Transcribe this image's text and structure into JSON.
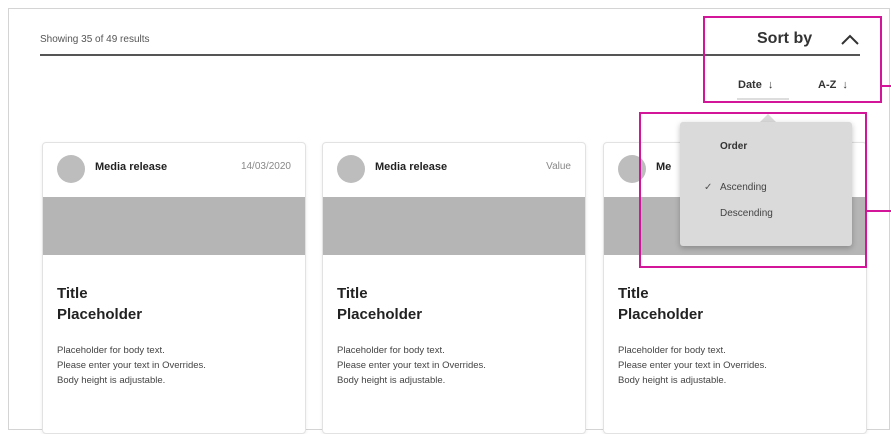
{
  "results_text": "Showing 35 of 49 results",
  "sort": {
    "label": "Sort by",
    "chevron_icon": "chevron-up-icon",
    "options": [
      {
        "label": "Date",
        "arrow": "↓"
      },
      {
        "label": "A-Z",
        "arrow": "↓"
      }
    ]
  },
  "popover": {
    "heading": "Order",
    "items": [
      {
        "label": "Ascending",
        "selected": true,
        "check": "✓"
      },
      {
        "label": "Descending",
        "selected": false
      }
    ]
  },
  "cards": [
    {
      "tag": "Media release",
      "meta": "14/03/2020",
      "title_line1": "Title",
      "title_line2": "Placeholder",
      "body1": "Placeholder for body text.",
      "body2": "Please enter your text in Overrides.",
      "body3": "Body height is adjustable."
    },
    {
      "tag": "Media release",
      "meta": "Value",
      "title_line1": "Title",
      "title_line2": "Placeholder",
      "body1": "Placeholder for body text.",
      "body2": "Please enter your text in Overrides.",
      "body3": "Body height is adjustable."
    },
    {
      "tag": "Me",
      "meta": "",
      "title_line1": "Title",
      "title_line2": "Placeholder",
      "body1": "Placeholder for body text.",
      "body2": "Please enter your text in Overrides.",
      "body3": "Body height is adjustable."
    }
  ],
  "colors": {
    "highlight": "#d3159a",
    "placeholder_image": "#b5b5b5",
    "popover_bg": "#dadada"
  }
}
